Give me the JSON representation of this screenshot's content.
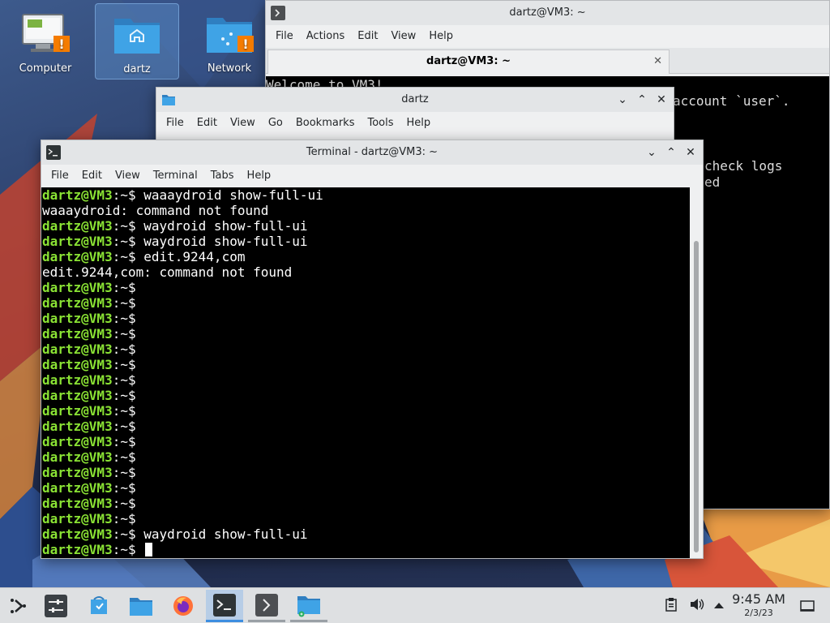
{
  "desktop": {
    "icons": [
      {
        "label": "Computer"
      },
      {
        "label": "dartz"
      },
      {
        "label": "Network"
      }
    ]
  },
  "konsole": {
    "title": "dartz@VM3: ~",
    "menu": [
      "File",
      "Actions",
      "Edit",
      "View",
      "Help"
    ],
    "tab_label": "dartz@VM3: ~",
    "tab_close": "✕",
    "lines": [
      "Welcome to VM3!",
      "account `user`.",
      "check logs",
      "ed"
    ]
  },
  "dolphin": {
    "title": "dartz",
    "menu": [
      "File",
      "Edit",
      "View",
      "Go",
      "Bookmarks",
      "Tools",
      "Help"
    ]
  },
  "terminal": {
    "title": "Terminal - dartz@VM3: ~",
    "menu": [
      "File",
      "Edit",
      "View",
      "Terminal",
      "Tabs",
      "Help"
    ],
    "prompt": "dartz@VM3",
    "prompt_suffix": ":~$ ",
    "lines": [
      {
        "type": "cmd",
        "text": "waaaydroid show-full-ui"
      },
      {
        "type": "out",
        "text": "waaaydroid: command not found"
      },
      {
        "type": "cmd",
        "text": "waydroid show-full-ui"
      },
      {
        "type": "cmd",
        "text": "waydroid show-full-ui"
      },
      {
        "type": "cmd",
        "text": "edit.9244,com"
      },
      {
        "type": "out",
        "text": "edit.9244,com: command not found"
      },
      {
        "type": "cmd",
        "text": ""
      },
      {
        "type": "cmd",
        "text": ""
      },
      {
        "type": "cmd",
        "text": ""
      },
      {
        "type": "cmd",
        "text": ""
      },
      {
        "type": "cmd",
        "text": ""
      },
      {
        "type": "cmd",
        "text": ""
      },
      {
        "type": "cmd",
        "text": ""
      },
      {
        "type": "cmd",
        "text": ""
      },
      {
        "type": "cmd",
        "text": ""
      },
      {
        "type": "cmd",
        "text": ""
      },
      {
        "type": "cmd",
        "text": ""
      },
      {
        "type": "cmd",
        "text": ""
      },
      {
        "type": "cmd",
        "text": ""
      },
      {
        "type": "cmd",
        "text": ""
      },
      {
        "type": "cmd",
        "text": ""
      },
      {
        "type": "cmd",
        "text": ""
      },
      {
        "type": "cmd",
        "text": "waydroid show-full-ui"
      },
      {
        "type": "cursor",
        "text": ""
      }
    ]
  },
  "taskbar": {
    "time": "9:45 AM",
    "date": "2/3/23"
  },
  "colors": {
    "prompt": "#8ae234",
    "accent": "#3d8ee0"
  }
}
